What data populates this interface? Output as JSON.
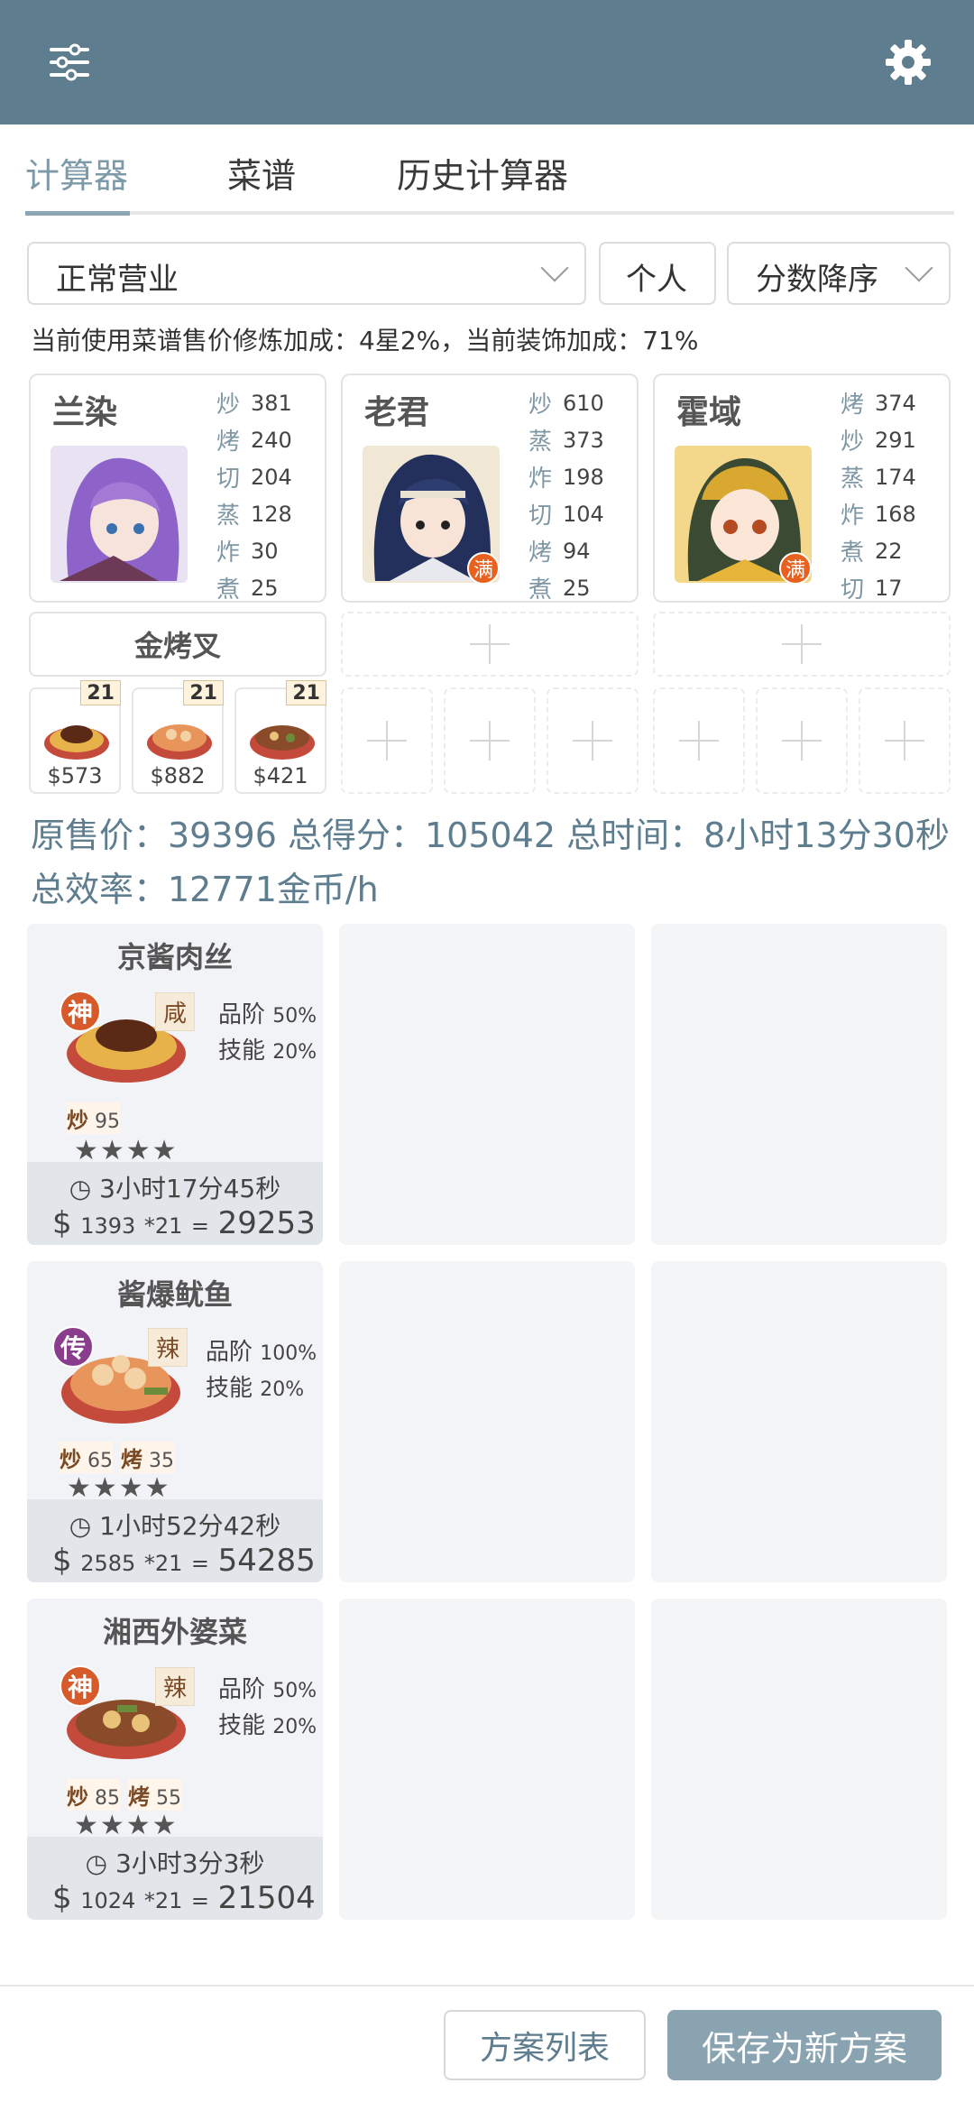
{
  "header": {
    "left_icon": "sliders-icon",
    "right_icon": "gear-icon"
  },
  "tabs": [
    {
      "label": "计算器",
      "active": true
    },
    {
      "label": "菜谱",
      "active": false
    },
    {
      "label": "历史计算器",
      "active": false
    }
  ],
  "filters": {
    "mode": "正常营业",
    "scope": "个人",
    "sort": "分数降序"
  },
  "info_line": "当前使用菜谱售价修炼加成：4星2%，当前装饰加成：71%",
  "chefs": [
    {
      "name": "兰染",
      "skills": [
        {
          "k": "炒",
          "v": "381"
        },
        {
          "k": "烤",
          "v": "240"
        },
        {
          "k": "切",
          "v": "204"
        },
        {
          "k": "蒸",
          "v": "128"
        },
        {
          "k": "炸",
          "v": "30"
        },
        {
          "k": "煮",
          "v": "25"
        }
      ],
      "badge": ""
    },
    {
      "name": "老君",
      "skills": [
        {
          "k": "炒",
          "v": "610"
        },
        {
          "k": "蒸",
          "v": "373"
        },
        {
          "k": "炸",
          "v": "198"
        },
        {
          "k": "切",
          "v": "104"
        },
        {
          "k": "烤",
          "v": "94"
        },
        {
          "k": "煮",
          "v": "25"
        }
      ],
      "badge": "满"
    },
    {
      "name": "霍域",
      "skills": [
        {
          "k": "烤",
          "v": "374"
        },
        {
          "k": "炒",
          "v": "291"
        },
        {
          "k": "蒸",
          "v": "174"
        },
        {
          "k": "炸",
          "v": "168"
        },
        {
          "k": "煮",
          "v": "22"
        },
        {
          "k": "切",
          "v": "17"
        }
      ],
      "badge": "满"
    }
  ],
  "equipment": [
    {
      "label": "金烤叉"
    }
  ],
  "dishes_slots": [
    {
      "count": "21",
      "price": "$573"
    },
    {
      "count": "21",
      "price": "$882"
    },
    {
      "count": "21",
      "price": "$421"
    }
  ],
  "summary": "原售价：39396 总得分：105042 总时间：8小时13分30秒 总效率：12771金币/h",
  "recipes": [
    {
      "name": "京酱肉丝",
      "rarity": "神",
      "rarity_color": "#d65a2a",
      "taste": "咸",
      "quality": "品阶",
      "quality_pct": "50%",
      "skill": "技能",
      "skill_pct": "20%",
      "reqs": [
        {
          "k": "炒",
          "v": "95"
        }
      ],
      "stars": "★★★★",
      "time": "3小时17分45秒",
      "unit": "1393",
      "mult": "*21",
      "total": "29253"
    },
    {
      "name": "酱爆鱿鱼",
      "rarity": "传",
      "rarity_color": "#8a3d8c",
      "taste": "辣",
      "quality": "品阶",
      "quality_pct": "100%",
      "skill": "技能",
      "skill_pct": "20%",
      "reqs": [
        {
          "k": "炒",
          "v": "65"
        },
        {
          "k": "烤",
          "v": "35"
        }
      ],
      "stars": "★★★★",
      "time": "1小时52分42秒",
      "unit": "2585",
      "mult": "*21",
      "total": "54285"
    },
    {
      "name": "湘西外婆菜",
      "rarity": "神",
      "rarity_color": "#d65a2a",
      "taste": "辣",
      "quality": "品阶",
      "quality_pct": "50%",
      "skill": "技能",
      "skill_pct": "20%",
      "reqs": [
        {
          "k": "炒",
          "v": "85"
        },
        {
          "k": "烤",
          "v": "55"
        }
      ],
      "stars": "★★★★",
      "time": "3小时3分3秒",
      "unit": "1024",
      "mult": "*21",
      "total": "21504"
    }
  ],
  "buttons": {
    "list": "方案列表",
    "save": "保存为新方案"
  }
}
